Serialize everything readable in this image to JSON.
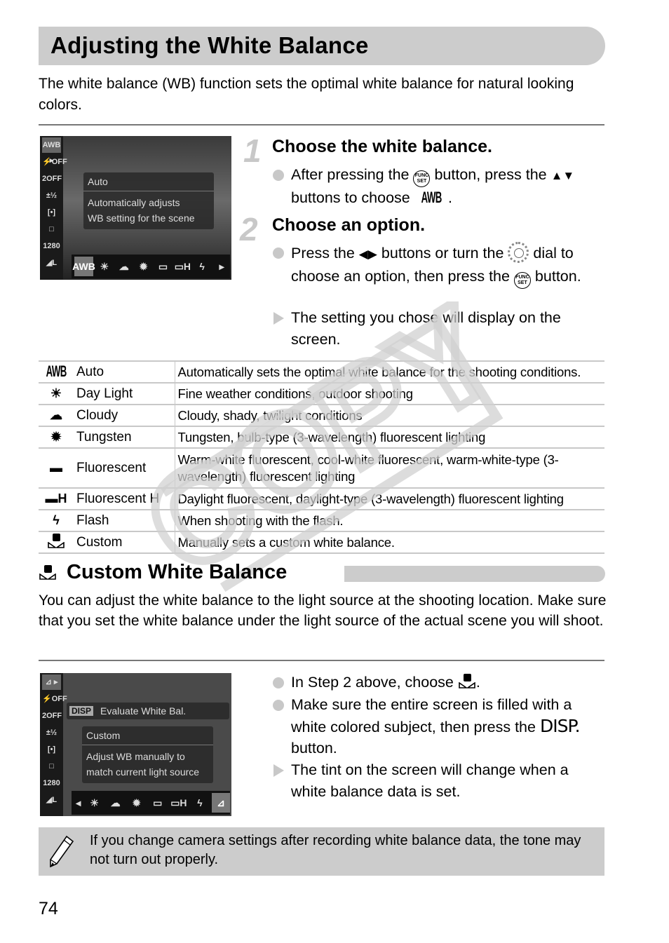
{
  "page": {
    "title": "Adjusting the White Balance",
    "intro": "The white balance (WB) function sets the optimal white balance for natural looking colors.",
    "page_number": "74",
    "watermark": "COPY"
  },
  "screen1": {
    "side_icons": [
      "AWB ▸",
      "⚡OFF",
      "2OFF",
      "±½",
      "[•]",
      "□",
      "1280",
      "◢L"
    ],
    "panel_title": "Auto",
    "panel_desc_line1": "Automatically adjusts",
    "panel_desc_line2": "WB setting for the scene",
    "bottom_icons": [
      "AWB",
      "☀",
      "☁",
      "✹",
      "▭",
      "▭H",
      "ϟ",
      "▸"
    ],
    "selected": "AWB"
  },
  "steps": [
    {
      "number": "1",
      "title": "Choose the white balance.",
      "bullets": [
        {
          "type": "circle",
          "parts": [
            "After pressing the ",
            " button, press the ",
            " buttons to choose ",
            "."
          ],
          "func_label_top": "FUNC",
          "func_label_bottom": "SET",
          "arrows": "▲▼",
          "awb": "AWB"
        }
      ]
    },
    {
      "number": "2",
      "title": "Choose an option.",
      "bullets": [
        {
          "type": "circle",
          "parts": [
            "Press the ",
            " buttons or turn the ",
            " dial to choose an option, then press the ",
            " button."
          ],
          "arrows": "◀▶",
          "func_label_top": "FUNC",
          "func_label_bottom": "SET"
        },
        {
          "type": "triangle",
          "text": "The setting you chose will display on the screen."
        }
      ]
    }
  ],
  "wb_table": [
    {
      "icon": "awb-icon",
      "glyph": "AWB",
      "name": "Auto",
      "description": "Automatically sets the optimal white balance for the shooting conditions."
    },
    {
      "icon": "daylight-icon",
      "glyph": "☀",
      "name": "Day Light",
      "description": "Fine weather conditions, outdoor shooting"
    },
    {
      "icon": "cloudy-icon",
      "glyph": "☁",
      "name": "Cloudy",
      "description": "Cloudy, shady, twilight conditions"
    },
    {
      "icon": "tungsten-icon",
      "glyph": "✹",
      "name": "Tungsten",
      "description": "Tungsten, bulb-type (3-wavelength) fluorescent lighting"
    },
    {
      "icon": "fluorescent-icon",
      "glyph": "▬",
      "name": "Fluorescent",
      "description": "Warm-white fluorescent, cool-white fluorescent, warm-white-type (3-wavelength) fluorescent lighting"
    },
    {
      "icon": "fluorescent-h-icon",
      "glyph": "▬H",
      "name": "Fluorescent H",
      "description": "Daylight fluorescent, daylight-type (3-wavelength) fluorescent lighting"
    },
    {
      "icon": "flash-icon",
      "glyph": "ϟ",
      "name": "Flash",
      "description": "When shooting with the flash."
    },
    {
      "icon": "custom-icon",
      "glyph": "",
      "name": "Custom",
      "description": "Manually sets a custom white balance."
    }
  ],
  "custom_section": {
    "title": "Custom White Balance",
    "intro": "You can adjust the white balance to the light source at the shooting location. Make sure that you set the white balance under the light source of the actual scene you will shoot.",
    "bullets": [
      {
        "type": "circle",
        "before": "In Step 2 above, choose ",
        "after": "."
      },
      {
        "type": "circle",
        "before": "Make sure the entire screen is filled with a white colored subject, then press the ",
        "disp": "DISP.",
        "after": " button."
      },
      {
        "type": "triangle",
        "text": "The tint on the screen will change when a white balance data is set."
      }
    ]
  },
  "screen2": {
    "disp_label": "DISP",
    "disp_action": "Evaluate White Bal.",
    "panel_title": "Custom",
    "panel_desc_line1": "Adjust WB manually to",
    "panel_desc_line2": "match current light source",
    "side_icons": [
      "⊿ ▸",
      "⚡OFF",
      "2OFF",
      "±½",
      "[•]",
      "□",
      "1280",
      "◢L"
    ],
    "bottom_icons": [
      "◂",
      "☀",
      "☁",
      "✹",
      "▭",
      "▭H",
      "ϟ",
      "⊿"
    ],
    "selected": "Custom"
  },
  "note": {
    "text": "If you change camera settings after recording white balance data, the tone may not turn out properly."
  }
}
